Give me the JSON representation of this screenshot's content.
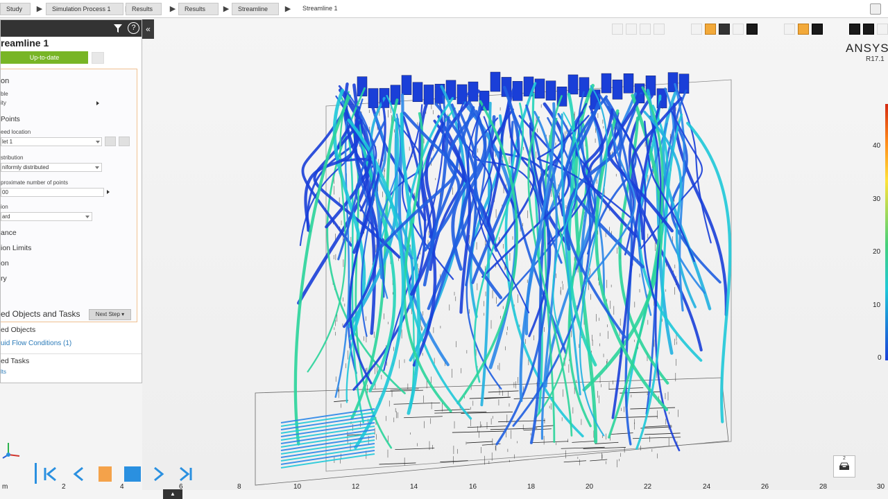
{
  "breadcrumb": {
    "items": [
      "Study",
      "Simulation Process 1",
      "Results",
      "Results",
      "Streamline",
      "Streamline 1"
    ]
  },
  "panel": {
    "help_glyph": "?",
    "collapse_glyph": "«",
    "title": "reamline 1",
    "status": "Up-to-date",
    "section_header": "on",
    "variable_label": "ble",
    "variable_value": "ity",
    "points_header": "Points",
    "seed_location_label": "eed location",
    "seed_location_value": "let 1",
    "distribution_label": "stribution",
    "distribution_value": "niformly distributed",
    "approx_label": "proximate number of points",
    "approx_value": "00",
    "direction_label": "ion",
    "direction_value": "ard",
    "appearance": "ance",
    "limits": "ion Limits",
    "location": "on",
    "summary": "ry",
    "next_step": "Next Step",
    "objects_tasks": "ed Objects and Tasks",
    "used_objects": "ed Objects",
    "flow_link": "uid Flow Conditions (1)",
    "used_tasks": "ed Tasks",
    "tasks_link": "lts"
  },
  "viewport": {
    "brand": "ANSYS",
    "version": "R17.1"
  },
  "legend": {
    "ticks": [
      "40",
      "30",
      "20",
      "10",
      "0"
    ]
  },
  "timeline": {
    "labels": [
      "m",
      "2",
      "4",
      "6",
      "8",
      "10",
      "12",
      "14",
      "16",
      "18",
      "20",
      "22",
      "24",
      "26",
      "28",
      "30"
    ],
    "inbox_count": "2"
  },
  "icons": {
    "first": "skip-first-icon",
    "prev": "previous-icon",
    "pause": "pause-icon",
    "stop": "stop-icon",
    "next": "next-icon",
    "last": "skip-last-icon"
  },
  "colors": {
    "status_green": "#78b526",
    "link_blue": "#2a7ab8",
    "play_blue": "#2a90e0",
    "accent_orange": "#f4a24a"
  }
}
